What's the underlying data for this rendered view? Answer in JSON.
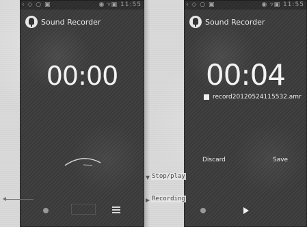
{
  "left_screen": {
    "status_left": "‹ ◇ ○ ▣",
    "status_right": "◉ ▿▣ 11:55",
    "app_title": "Sound Recorder",
    "timer": "00:00"
  },
  "right_screen": {
    "status_left": "‹ ◇ ○ ▣",
    "status_right": "◉ ▿▣ 11:55",
    "app_title": "Sound Recorder",
    "timer": "00:04",
    "filename": "record20120524115532.amr",
    "discard_label": "Discard",
    "save_label": "Save"
  },
  "annotations": {
    "stop_play": "Stop/play",
    "recording": "Recording"
  },
  "colors": {
    "phone_bg": "#3b3b3b",
    "text": "#f2f2f2",
    "muted": "#999999"
  }
}
